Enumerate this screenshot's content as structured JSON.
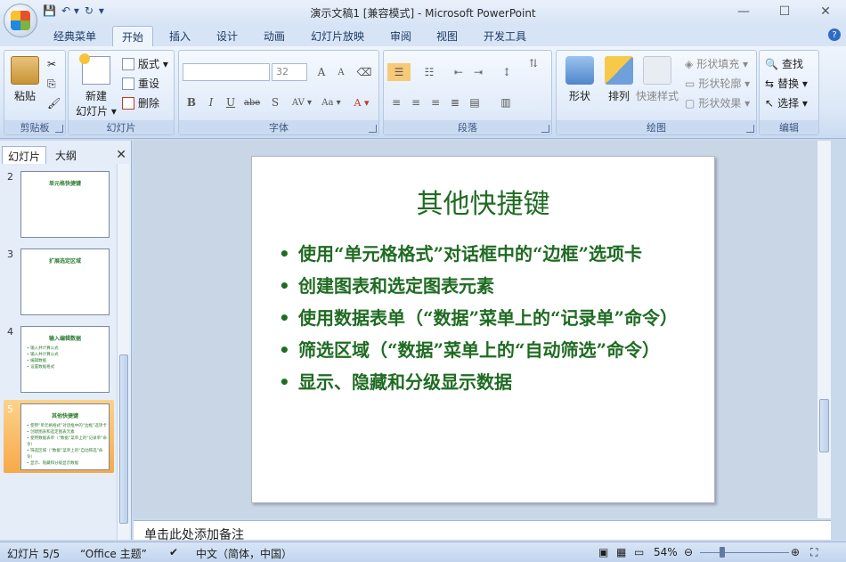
{
  "window": {
    "title": "演示文稿1 [兼容模式] - Microsoft PowerPoint",
    "controls": [
      "—",
      "☐",
      "✕"
    ]
  },
  "qat": [
    "💾",
    "↶ ▾",
    "↻",
    "▾"
  ],
  "tabs": [
    "经典菜单",
    "开始",
    "插入",
    "设计",
    "动画",
    "幻灯片放映",
    "审阅",
    "视图",
    "开发工具"
  ],
  "active_tab": "开始",
  "ribbon": {
    "clipboard": {
      "label": "剪贴板",
      "paste": "粘贴"
    },
    "slides": {
      "label": "幻灯片",
      "new_slide": "新建\n幻灯片",
      "new_slide_l1": "新建",
      "new_slide_l2": "幻灯片 ▾",
      "layout": "版式 ▾",
      "reset": "重设",
      "delete": "删除"
    },
    "font": {
      "label": "字体",
      "size": "32",
      "bold": "B",
      "italic": "I",
      "underline": "U",
      "strike": "abe",
      "shadow": "S",
      "spacing": "AV ▾",
      "case": "Aa ▾",
      "color": "A ▾",
      "grow": "A",
      "shrink": "A"
    },
    "paragraph": {
      "label": "段落"
    },
    "drawing": {
      "label": "绘图",
      "shapes": "形状",
      "arrange": "排列",
      "quick_styles": "快速样式",
      "fill": "形状填充 ▾",
      "outline": "形状轮廓 ▾",
      "effects": "形状效果 ▾"
    },
    "editing": {
      "label": "编辑",
      "find": "查找",
      "replace": "替换 ▾",
      "select": "选择 ▾"
    }
  },
  "left_panel": {
    "tabs": [
      "幻灯片",
      "大纲"
    ],
    "close": "✕",
    "thumbnails": [
      {
        "num": "2",
        "title": "单元格快捷键",
        "lines": []
      },
      {
        "num": "3",
        "title": "扩展选定区域",
        "lines": []
      },
      {
        "num": "4",
        "title": "输入编辑数据",
        "lines": [
          "• 输入并计算公式",
          "• 输入并计算公式",
          "• 编辑数据",
          "• 设置数据格式"
        ]
      },
      {
        "num": "5",
        "title": "其他快捷键",
        "lines": [
          "• 使用“单元格格式”对话框中的“边框”选项卡",
          "• 创建图表和选定图表元素",
          "• 使用数据表单（“数据”菜单上的“记录单”命令）",
          "• 筛选区域（“数据”菜单上的“自动筛选”命令）",
          "• 显示、隐藏和分级显示数据"
        ]
      }
    ],
    "selected": "5"
  },
  "slide": {
    "title": "其他快捷键",
    "bullets": [
      "使用“单元格格式”对话框中的“边框”选项卡",
      "创建图表和选定图表元素",
      "使用数据表单（“数据”菜单上的“记录单”命令）",
      "筛选区域（“数据”菜单上的“自动筛选”命令）",
      "显示、隐藏和分级显示数据"
    ]
  },
  "notes": {
    "placeholder": "单击此处添加备注"
  },
  "statusbar": {
    "slide_count": "幻灯片 5/5",
    "theme": "“Office 主题”",
    "language": "中文（简体，中国）",
    "zoom": "54%"
  }
}
